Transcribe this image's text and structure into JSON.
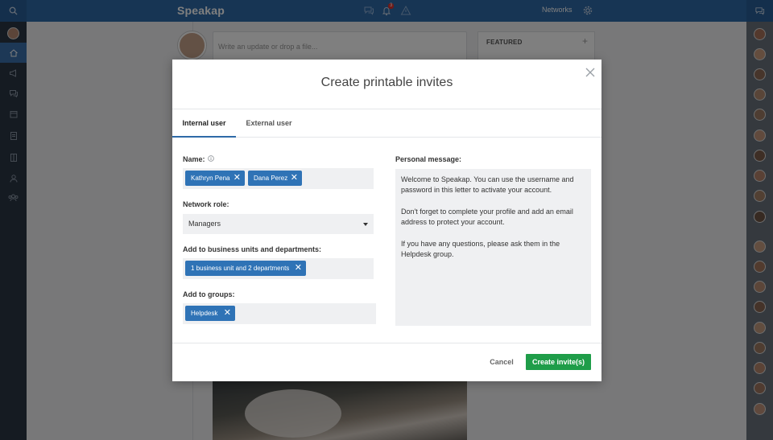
{
  "app": {
    "brand": "Speakap",
    "networks_label": "Networks",
    "notification_count": "3"
  },
  "feed": {
    "composer_placeholder": "Write an update or drop a file...",
    "featured_label": "FEATURED"
  },
  "modal": {
    "title": "Create printable invites",
    "tabs": [
      {
        "label": "Internal user",
        "active": true
      },
      {
        "label": "External user",
        "active": false
      }
    ],
    "name_label": "Name:",
    "names": [
      "Kathryn Pena",
      "Dana Perez"
    ],
    "role_label": "Network role:",
    "role_value": "Managers",
    "units_label": "Add to business units and departments:",
    "units_chip": "1 business unit and 2 departments",
    "groups_label": "Add to groups:",
    "groups_chip": "Helpdesk",
    "message_label": "Personal message:",
    "message_paragraphs": [
      "Welcome to Speakap. You can use the username and password in this letter to activate your account.",
      "Don't forget to complete your profile and add an email address to protect your account.",
      "If you have any questions, please ask them in the Helpdesk group."
    ],
    "cancel_label": "Cancel",
    "create_label": "Create invite(s)"
  },
  "colors": {
    "topbar": "#2e6aa8",
    "chip": "#2f73b6",
    "create_button": "#1f9d49",
    "left_nav": "#2b3645"
  }
}
